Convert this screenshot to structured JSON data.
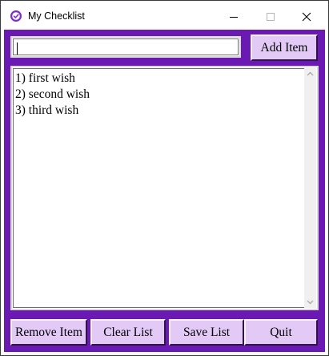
{
  "window": {
    "title": "My Checklist",
    "accent_color": "#6a19b3",
    "button_color": "#e2c9f6"
  },
  "titlebar": {
    "icons": [
      "app-check-icon",
      "minimize-icon",
      "maximize-icon",
      "close-icon"
    ]
  },
  "entry": {
    "value": ""
  },
  "toolbar": {
    "add_label": "Add Item"
  },
  "list": {
    "items": [
      "1) first wish",
      "2) second wish",
      "3) third wish"
    ]
  },
  "actions": {
    "remove_label": "Remove Item",
    "clear_label": "Clear List",
    "save_label": "Save List",
    "quit_label": "Quit"
  }
}
